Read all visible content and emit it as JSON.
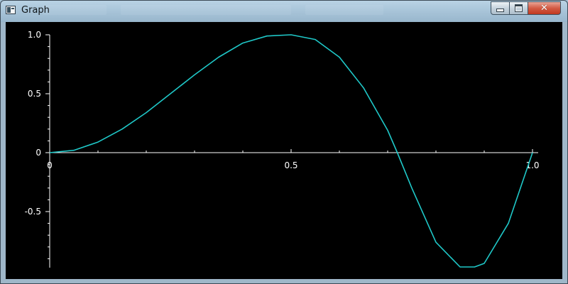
{
  "window": {
    "title": "Graph",
    "controls": {
      "minimize_icon": "minimize-icon",
      "maximize_icon": "maximize-icon",
      "close_icon": "close-icon",
      "close_glyph": "✕"
    }
  },
  "colors": {
    "background": "#000000",
    "axis": "#ffffff",
    "curve": "#1fc8c8"
  },
  "chart_data": {
    "type": "line",
    "title": "",
    "xlabel": "",
    "ylabel": "",
    "xlim": [
      0,
      1.0
    ],
    "ylim": [
      -0.97,
      1.0
    ],
    "x_tick_labels": [
      "0",
      "0.5",
      "1.0"
    ],
    "y_tick_labels": [
      "1.0",
      "0.5",
      "0",
      "-0.5"
    ],
    "grid": false,
    "legend": "none",
    "series": [
      {
        "x": [
          0,
          0.05,
          0.1,
          0.15,
          0.2,
          0.25,
          0.3,
          0.35,
          0.4,
          0.45,
          0.5,
          0.55,
          0.6,
          0.65,
          0.7,
          0.72,
          0.75,
          0.8,
          0.85,
          0.88,
          0.9,
          0.95,
          1.0
        ],
        "y": [
          0,
          0.02,
          0.09,
          0.2,
          0.34,
          0.5,
          0.66,
          0.81,
          0.93,
          0.99,
          1.0,
          0.96,
          0.81,
          0.55,
          0.19,
          0.0,
          -0.3,
          -0.76,
          -0.97,
          -0.97,
          -0.94,
          -0.6,
          0.0
        ]
      }
    ]
  }
}
